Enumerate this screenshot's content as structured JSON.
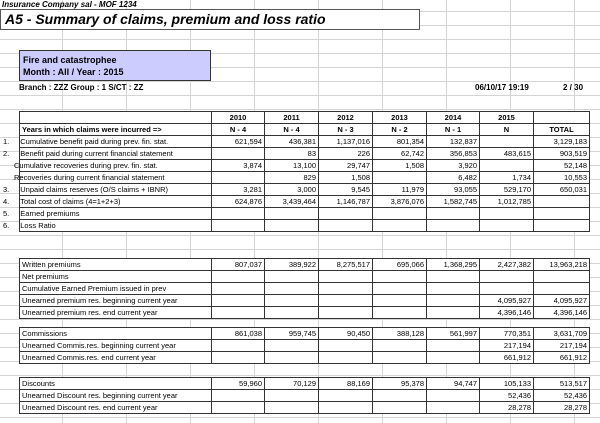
{
  "header": {
    "company": "Insurance Company sal - MOF 1234",
    "title": "A5 - Summary of claims, premium and loss ratio",
    "box_line1": "Fire and catastrophee",
    "box_line2": "Month : All / Year : 2015",
    "branch": "Branch : ZZZ Group : 1 S/CT : ZZ",
    "datetime": "06/10/17  19:19",
    "page": "2 / 30"
  },
  "years": [
    "2010",
    "2011",
    "2012",
    "2013",
    "2014",
    "2015"
  ],
  "periods": [
    "N - 4",
    "N - 4",
    "N - 3",
    "N - 2",
    "N - 1",
    "N",
    "TOTAL"
  ],
  "incurred_label": "Years in which claims were incurred =>",
  "claims_rows": [
    {
      "num": "1.",
      "label": "Cumulative benefit paid during prev. fin. stat.",
      "v": [
        "621,594",
        "436,381",
        "1,137,016",
        "801,354",
        "132,837",
        "",
        "3,129,183"
      ]
    },
    {
      "num": "2.",
      "label": "Benefit paid during current financial statement",
      "v": [
        "",
        "83",
        "226",
        "62,742",
        "356,853",
        "483,615",
        "903,519"
      ]
    },
    {
      "num": "",
      "label": "Cumulative recoveries during prev. fin. stat.",
      "v": [
        "3,874",
        "13,100",
        "29,747",
        "1,508",
        "3,920",
        "",
        "52,148"
      ]
    },
    {
      "num": "",
      "label": "Recoveries during current financial statement",
      "v": [
        "",
        "829",
        "1,508",
        "",
        "6,482",
        "1,734",
        "10,553"
      ]
    },
    {
      "num": "3.",
      "label": "Unpaid claims reserves (O/S claims + IBNR)",
      "v": [
        "3,281",
        "3,000",
        "9,545",
        "11,979",
        "93,055",
        "529,170",
        "650,031"
      ]
    },
    {
      "num": "4.",
      "label": "Total cost of claims (4=1+2+3)",
      "v": [
        "624,876",
        "3,439,464",
        "1,146,787",
        "3,876,076",
        "1,582,745",
        "1,012,785",
        ""
      ]
    },
    {
      "num": "5.",
      "label": "Earned premiums",
      "v": [
        "",
        "",
        "",
        "",
        "",
        "",
        ""
      ]
    },
    {
      "num": "6.",
      "label": "Loss Ratio",
      "v": [
        "",
        "",
        "",
        "",
        "",
        "",
        ""
      ]
    }
  ],
  "premium_rows": [
    {
      "label": "Written premiums",
      "v": [
        "807,037",
        "389,922",
        "8,275,517",
        "695,066",
        "1,368,295",
        "2,427,382",
        "13,963,218"
      ]
    },
    {
      "label": "Net premiums",
      "v": [
        "",
        "",
        "",
        "",
        "",
        "",
        ""
      ]
    },
    {
      "label": "Cumulative Earned Premium issued in prev",
      "v": [
        "",
        "",
        "",
        "",
        "",
        "",
        ""
      ]
    },
    {
      "label": "Unearned premium res. beginning current year",
      "v": [
        "",
        "",
        "",
        "",
        "",
        "4,095,927",
        "4,095,927"
      ]
    },
    {
      "label": "Unearned premium res. end current year",
      "v": [
        "",
        "",
        "",
        "",
        "",
        "4,396,146",
        "4,396,146"
      ]
    }
  ],
  "commission_rows": [
    {
      "label": "Commissions",
      "v": [
        "861,038",
        "959,745",
        "90,450",
        "388,128",
        "561,997",
        "770,351",
        "3,631,709"
      ]
    },
    {
      "label": "Unearned Commis.res. beginning current year",
      "v": [
        "",
        "",
        "",
        "",
        "",
        "217,194",
        "217,194"
      ]
    },
    {
      "label": "Unearned Commis.res. end current year",
      "v": [
        "",
        "",
        "",
        "",
        "",
        "661,912",
        "661,912"
      ]
    }
  ],
  "discount_rows": [
    {
      "label": "Discounts",
      "v": [
        "59,960",
        "70,129",
        "88,169",
        "95,378",
        "94,747",
        "105,133",
        "513,517"
      ]
    },
    {
      "label": "Unearned Discount res. beginning current year",
      "v": [
        "",
        "",
        "",
        "",
        "",
        "52,436",
        "52,436"
      ]
    },
    {
      "label": "Unearned Discount res. end current year",
      "v": [
        "",
        "",
        "",
        "",
        "",
        "28,278",
        "28,278"
      ]
    }
  ]
}
